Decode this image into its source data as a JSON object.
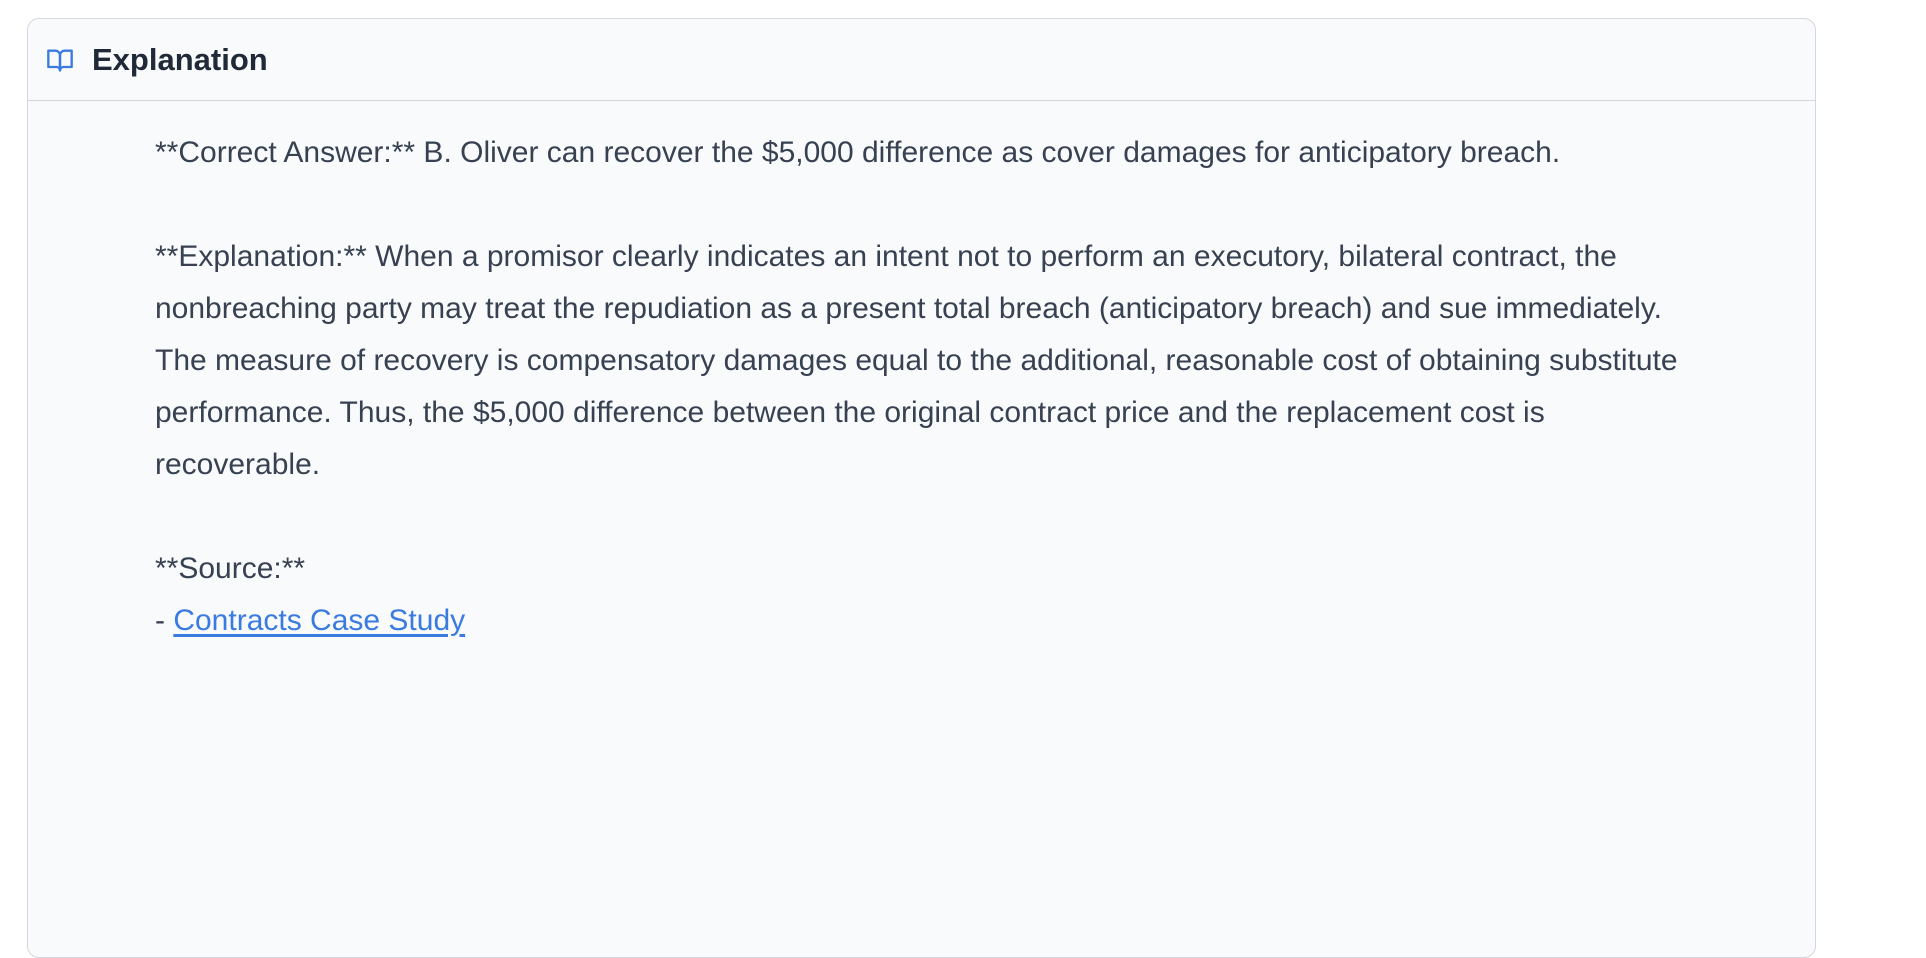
{
  "panel": {
    "title": "Explanation",
    "icon": "book-open-icon",
    "accent_color": "#3a7be0"
  },
  "content": {
    "correct_answer": "**Correct Answer:** B. Oliver can recover the $5,000 difference as cover damages for anticipatory breach.",
    "explanation": "**Explanation:** When a promisor clearly indicates an intent not to perform an executory, bilateral contract, the nonbreaching party may treat the repudiation as a present total breach (anticipatory breach) and sue immediately. The measure of recovery is compensatory damages equal to the additional, reasonable cost of obtaining substitute performance. Thus, the $5,000 difference between the original contract price and the replacement cost is recoverable.",
    "source_heading": "**Source:**",
    "source_bullet": "- ",
    "source_link_label": "Contracts Case Study"
  }
}
